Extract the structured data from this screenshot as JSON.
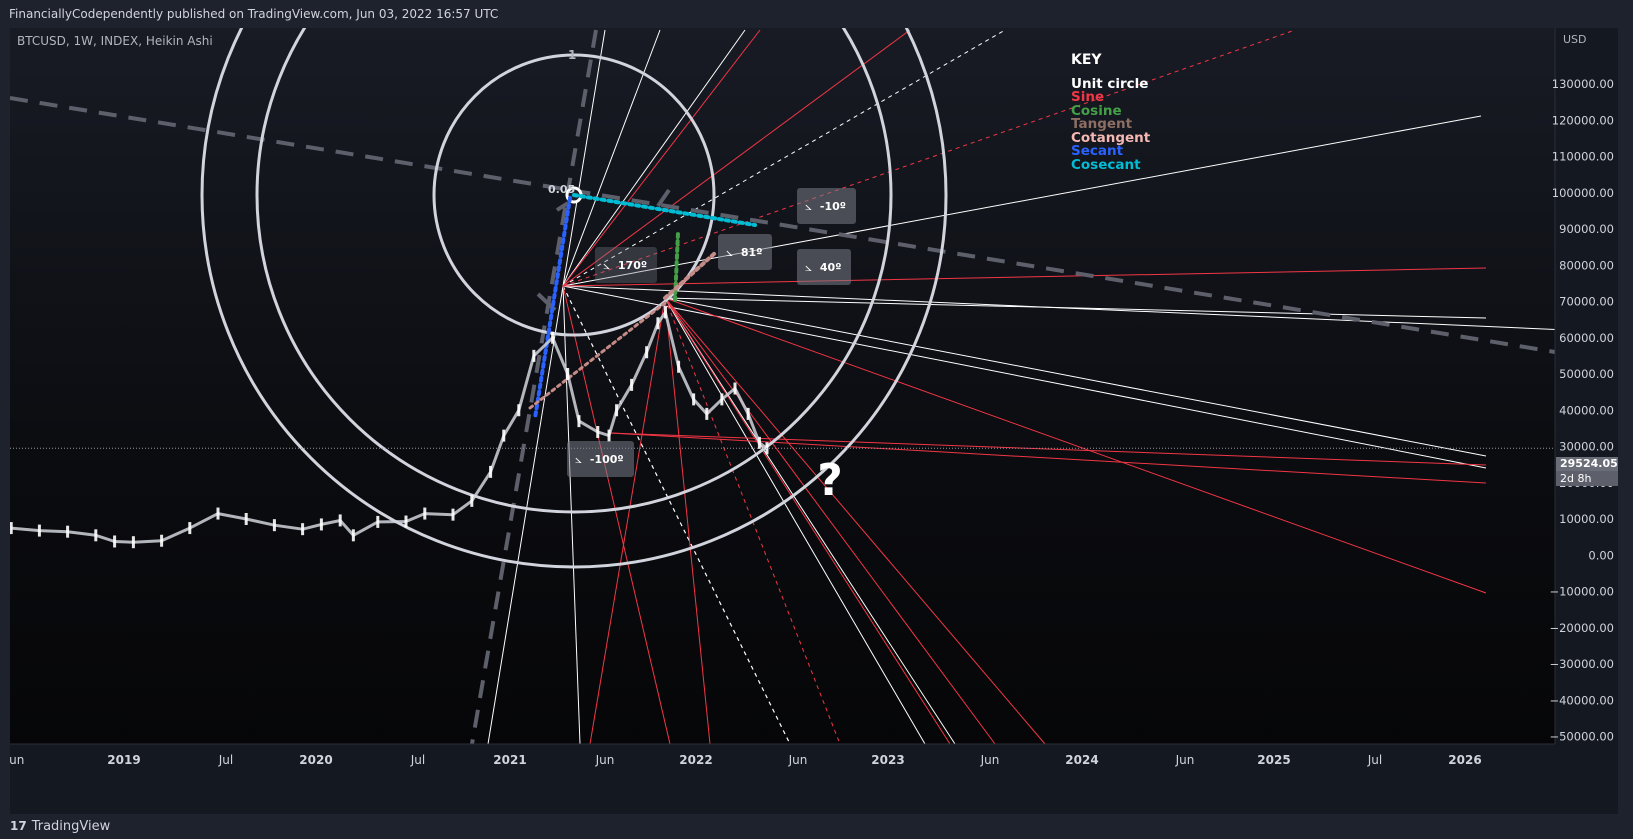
{
  "header": {
    "published_text": "FinanciallyCodependently published on TradingView.com, Jun 03, 2022 16:57 UTC",
    "symbol_line": "BTCUSD, 1W, INDEX, Heikin Ashi"
  },
  "footer": {
    "logo_mark": "17",
    "logo_text": "TradingView"
  },
  "key": {
    "title": "KEY",
    "items": [
      {
        "label": "Unit circle",
        "color": "#ffffff"
      },
      {
        "label": "Sine",
        "color": "#f23645"
      },
      {
        "label": "Cosine",
        "color": "#43a047"
      },
      {
        "label": "Tangent",
        "color": "#8d6e63"
      },
      {
        "label": "Cotangent",
        "color": "#f5b7b1"
      },
      {
        "label": "Secant",
        "color": "#2962ff"
      },
      {
        "label": "Cosecant",
        "color": "#00bcd4"
      }
    ]
  },
  "annotations": {
    "angle_boxes": [
      "-10º",
      "81º",
      "40º",
      "170º",
      "-100º"
    ],
    "origin_level": "0.05",
    "unit_label": "1",
    "question_mark": "?"
  },
  "chart_data": {
    "type": "candlestick",
    "series_name": "BTCUSD",
    "axis_currency": "USD",
    "y_ticks": [
      "130000.00",
      "120000.00",
      "110000.00",
      "100000.00",
      "90000.00",
      "80000.00",
      "70000.00",
      "60000.00",
      "50000.00",
      "40000.00",
      "30000.00",
      "20000.00",
      "10000.00",
      "0.00",
      "−10000.00",
      "−20000.00",
      "−30000.00",
      "−40000.00",
      "−50000.00"
    ],
    "x_ticks": [
      "Jun",
      "2019",
      "Jul",
      "2020",
      "Jul",
      "2021",
      "Jun",
      "2022",
      "Jun",
      "2023",
      "Jun",
      "2024",
      "Jun",
      "2025",
      "Jul",
      "2026"
    ],
    "ylim": [
      -53000,
      146000
    ],
    "last_price": "29524.05",
    "countdown": "2d 8h",
    "price_path": [
      [
        2018.4,
        7500
      ],
      [
        2018.55,
        6800
      ],
      [
        2018.7,
        6500
      ],
      [
        2018.85,
        5500
      ],
      [
        2018.95,
        3800
      ],
      [
        2019.05,
        3600
      ],
      [
        2019.2,
        4000
      ],
      [
        2019.35,
        7500
      ],
      [
        2019.5,
        11500
      ],
      [
        2019.65,
        10000
      ],
      [
        2019.8,
        8300
      ],
      [
        2019.95,
        7200
      ],
      [
        2020.05,
        8500
      ],
      [
        2020.15,
        9600
      ],
      [
        2020.22,
        5500
      ],
      [
        2020.35,
        9200
      ],
      [
        2020.5,
        9300
      ],
      [
        2020.6,
        11500
      ],
      [
        2020.75,
        11200
      ],
      [
        2020.85,
        15000
      ],
      [
        2020.95,
        23000
      ],
      [
        2021.02,
        33000
      ],
      [
        2021.1,
        40000
      ],
      [
        2021.18,
        55000
      ],
      [
        2021.28,
        60000
      ],
      [
        2021.36,
        50000
      ],
      [
        2021.42,
        37000
      ],
      [
        2021.52,
        34000
      ],
      [
        2021.58,
        33000
      ],
      [
        2021.62,
        40000
      ],
      [
        2021.7,
        47000
      ],
      [
        2021.78,
        56000
      ],
      [
        2021.84,
        64000
      ],
      [
        2021.88,
        67000
      ],
      [
        2021.95,
        52000
      ],
      [
        2022.03,
        43000
      ],
      [
        2022.1,
        39000
      ],
      [
        2022.18,
        43000
      ],
      [
        2022.25,
        46000
      ],
      [
        2022.32,
        39000
      ],
      [
        2022.38,
        31000
      ],
      [
        2022.42,
        29500
      ]
    ]
  }
}
